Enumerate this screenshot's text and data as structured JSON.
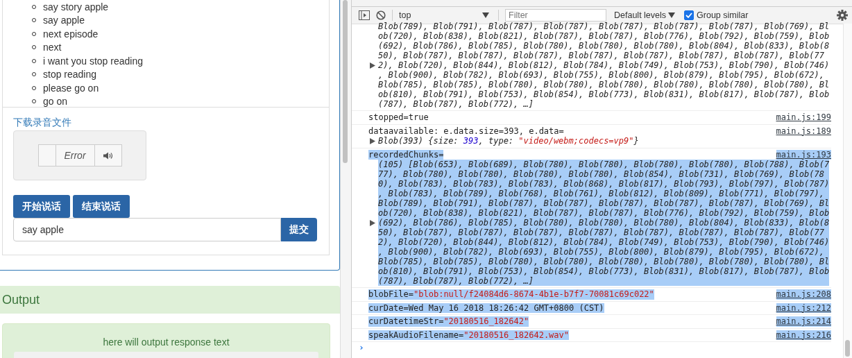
{
  "commands": [
    "say story apple",
    "say apple",
    "next episode",
    "next",
    "i want you stop reading",
    "stop reading",
    "please go on",
    "go on"
  ],
  "download_link": "下载录音文件",
  "audio_player": {
    "status": "Error"
  },
  "buttons": [
    {
      "label": "开始说话"
    },
    {
      "label": "结束说话"
    }
  ],
  "input": {
    "value": "say apple",
    "submit": "提交"
  },
  "output": {
    "title": "Output",
    "text": "here will output response text"
  },
  "devtools": {
    "toolbar": {
      "context": "top",
      "filter_placeholder": "Filter",
      "levels": "Default levels",
      "group_similar": {
        "label": "Group similar",
        "checked": true
      }
    },
    "messages": [
      {
        "selected": false,
        "lines": [
          "Blob(789), Blob(791), Blob(787), Blob(787), Blob(787), Blob(787), Blob(787), Blob(769), Bl",
          "ob(720), Blob(838), Blob(821), Blob(787), Blob(787), Blob(776), Blob(792), Blob(759), Blob",
          "(692), Blob(786), Blob(785), Blob(780), Blob(780), Blob(780), Blob(804), Blob(833), Blob(8",
          "50), Blob(787), Blob(787), Blob(787), Blob(787), Blob(787), Blob(787), Blob(787), Blob(77",
          "2), Blob(720), Blob(844), Blob(812), Blob(784), Blob(749), Blob(753), Blob(790), Blob(746)",
          ", Blob(900), Blob(782), Blob(693), Blob(755), Blob(800), Blob(879), Blob(795), Blob(672),",
          "Blob(785), Blob(785), Blob(780), Blob(780), Blob(780), Blob(780), Blob(780), Blob(780), Bl",
          "ob(810), Blob(791), Blob(753), Blob(854), Blob(773), Blob(831), Blob(817), Blob(787), Blob",
          "(787), Blob(787), Blob(772), …]"
        ]
      },
      {
        "selected": false,
        "source": "main.js:199",
        "segments": [
          {
            "text": "stopped=true",
            "kind": "plain"
          }
        ]
      },
      {
        "selected": false,
        "source": "main.js:189",
        "segments": [
          {
            "text": "dataavailable: e.data.size=393, e.data=",
            "kind": "plain"
          }
        ],
        "object": [
          {
            "text": "Blob(393) {size: ",
            "kind": "plain"
          },
          {
            "text": "393",
            "kind": "number"
          },
          {
            "text": ", type: ",
            "kind": "plain"
          },
          {
            "text": "\"video/webm;codecs=vp9\"",
            "kind": "string"
          },
          {
            "text": "}",
            "kind": "plain"
          }
        ]
      },
      {
        "selected": true,
        "source": "main.js:193",
        "segments": [
          {
            "text": "recordedChunks=",
            "kind": "plain"
          }
        ],
        "lines": [
          "(105) [Blob(653), Blob(689), Blob(780), Blob(780), Blob(780), Blob(780), Blob(788), Blob(7",
          "77), Blob(780), Blob(780), Blob(780), Blob(780), Blob(854), Blob(731), Blob(769), Blob(78",
          "0), Blob(783), Blob(783), Blob(783), Blob(868), Blob(817), Blob(793), Blob(797), Blob(787)",
          ", Blob(783), Blob(789), Blob(768), Blob(761), Blob(812), Blob(809), Blob(771), Blob(797),",
          "Blob(789), Blob(791), Blob(787), Blob(787), Blob(787), Blob(787), Blob(787), Blob(769), Bl",
          "ob(720), Blob(838), Blob(821), Blob(787), Blob(787), Blob(776), Blob(792), Blob(759), Blob",
          "(692), Blob(786), Blob(785), Blob(780), Blob(780), Blob(780), Blob(804), Blob(833), Blob(8",
          "50), Blob(787), Blob(787), Blob(787), Blob(787), Blob(787), Blob(787), Blob(787), Blob(77",
          "2), Blob(720), Blob(844), Blob(812), Blob(784), Blob(749), Blob(753), Blob(790), Blob(746)",
          ", Blob(900), Blob(782), Blob(693), Blob(755), Blob(800), Blob(879), Blob(795), Blob(672),",
          "Blob(785), Blob(785), Blob(780), Blob(780), Blob(780), Blob(780), Blob(780), Blob(780), Bl",
          "ob(810), Blob(791), Blob(753), Blob(854), Blob(773), Blob(831), Blob(817), Blob(787), Blob",
          "(787), Blob(787), Blob(772), …]"
        ]
      },
      {
        "selected": true,
        "source": "main.js:208",
        "segments": [
          {
            "text": "blobFile=",
            "kind": "plain"
          },
          {
            "text": "\"blob:null/f24084d6-8674-4b1e-b7f7-70081c69c022\"",
            "kind": "string"
          }
        ]
      },
      {
        "selected": true,
        "source": "main.js:212",
        "segments": [
          {
            "text": "curDate=Wed May 16 2018 18:26:42 GMT+0800 (CST)",
            "kind": "plain"
          }
        ]
      },
      {
        "selected": true,
        "source": "main.js:214",
        "segments": [
          {
            "text": "curDatetimeStr=",
            "kind": "plain"
          },
          {
            "text": "\"20180516_182642\"",
            "kind": "string"
          }
        ]
      },
      {
        "selected": true,
        "source": "main.js:216",
        "segments": [
          {
            "text": "speakAudioFilename=",
            "kind": "plain"
          },
          {
            "text": "\"20180516_182642.wav\"",
            "kind": "string"
          }
        ]
      }
    ],
    "prompt": "›"
  }
}
